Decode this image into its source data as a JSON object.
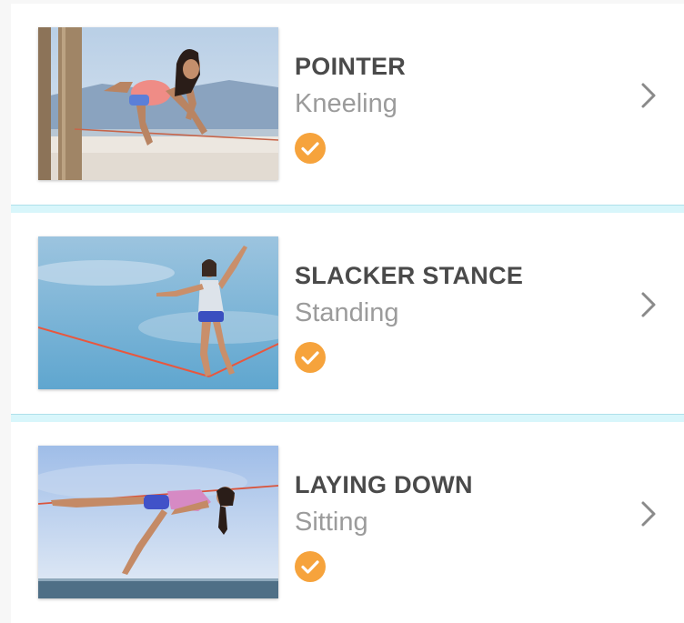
{
  "items": [
    {
      "title": "POINTER",
      "subtitle": "Kneeling",
      "completed": true,
      "image": "slackline-pointer-photo"
    },
    {
      "title": "SLACKER STANCE",
      "subtitle": "Standing",
      "completed": true,
      "image": "slackline-stance-photo"
    },
    {
      "title": "LAYING DOWN",
      "subtitle": "Sitting",
      "completed": true,
      "image": "slackline-laying-photo"
    }
  ],
  "colors": {
    "title": "#4a4a4a",
    "subtitle": "#9b9b9b",
    "check_badge": "#f6a33c",
    "separator": "#d8f6fb",
    "chevron": "#8a8a8a"
  },
  "icons": {
    "completed": "check-circle-icon",
    "open": "chevron-right-icon"
  }
}
